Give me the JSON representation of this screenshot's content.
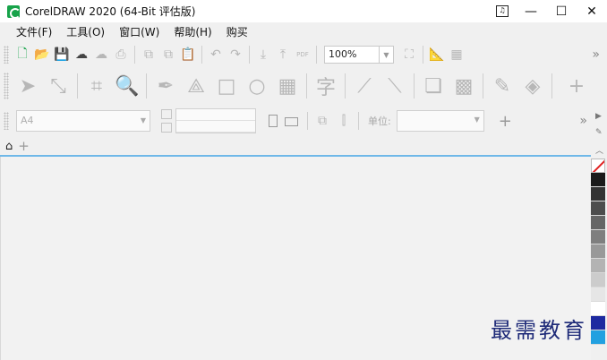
{
  "window": {
    "title": "CorelDRAW 2020 (64-Bit 评估版)",
    "controls": {
      "minimize": "—",
      "maximize": "☐",
      "close": "✕"
    }
  },
  "menu": {
    "items": [
      "文件(F)",
      "工具(O)",
      "窗口(W)",
      "帮助(H)",
      "购买"
    ]
  },
  "standard_toolbar": {
    "zoom_value": "100%",
    "icons": [
      "new-document-icon",
      "open-icon",
      "save-icon",
      "cloud-download-icon",
      "cloud-upload-icon",
      "print-icon",
      "copy-icon",
      "paste-icon",
      "clipboard-icon",
      "undo-icon",
      "redo-icon",
      "import-icon",
      "export-icon",
      "export-pdf-icon",
      "full-screen-icon",
      "rulers-icon",
      "grid-icon"
    ],
    "pdf_label": "PDF"
  },
  "tools_toolbar": {
    "icons": [
      "pick-tool-icon",
      "shape-tool-icon",
      "crop-tool-icon",
      "zoom-tool-icon",
      "pen-tool-icon",
      "parallel-dimension-icon",
      "rectangle-tool-icon",
      "ellipse-tool-icon",
      "table-tool-icon",
      "text-tool-icon",
      "connector-tool-icon",
      "blend-tool-icon",
      "drop-shadow-icon",
      "transparency-tool-icon",
      "eyedropper-icon",
      "fill-tool-icon",
      "add-tool-icon"
    ],
    "text_tool_glyph": "字"
  },
  "property_bar": {
    "page_size": "A4",
    "unit_label": "单位:",
    "unit_value": ""
  },
  "tabs": {
    "home_icon": "home-icon",
    "add_icon": "+"
  },
  "palette": {
    "colors": [
      "#1a1a1a",
      "#333333",
      "#4d4d4d",
      "#666666",
      "#7f7f7f",
      "#999999",
      "#b3b3b3",
      "#cccccc",
      "#e6e6e6",
      "#ffffff",
      "#1e2aa0",
      "#22a0e0"
    ]
  },
  "watermark": "最需教育"
}
